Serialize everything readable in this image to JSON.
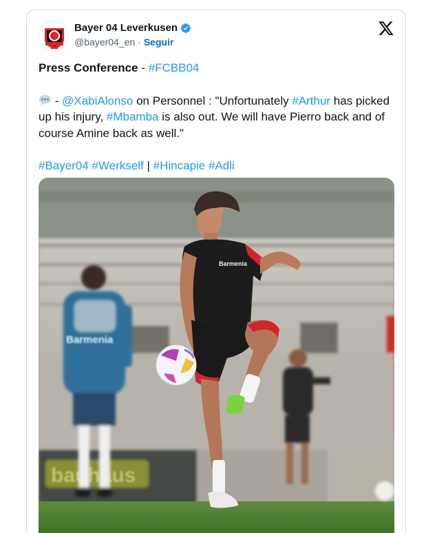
{
  "tweet": {
    "author_name": "Bayer 04 Leverkusen",
    "handle": "@bayer04_en",
    "separator": "·",
    "follow_label": "Seguir",
    "heading": "Press Conference",
    "heading_dash": " - ",
    "heading_tag": "#FCBB04",
    "speech_icon": "speech-balloon-icon",
    "quote_dash": " - ",
    "mention": "@XabiAlonso",
    "quote_intro": " on Personnel : \"Unfortunately ",
    "tag_arthur": "#Arthur",
    "quote_mid": " has picked up his injury, ",
    "tag_mbamba": "#Mbamba",
    "quote_end": " is also out. We will have Pierro back and of course Amine back as well.\"",
    "tag_bayer04": "#Bayer04",
    "tag_werkself": "#Werkself",
    "pipe": " | ",
    "tag_hincapie": "#Hincapie",
    "tag_adli": "#Adli",
    "photo_sponsor_shirt": "Barmenia",
    "photo_sponsor_jacket": "Barmenia",
    "photo_banner_text": "bauhaus"
  },
  "colors": {
    "link": "#1d9bf0",
    "follow": "#006fd6",
    "text": "#0f1419",
    "muted": "#536471",
    "verified": "#1d9bf0",
    "club_red": "#e32221"
  }
}
